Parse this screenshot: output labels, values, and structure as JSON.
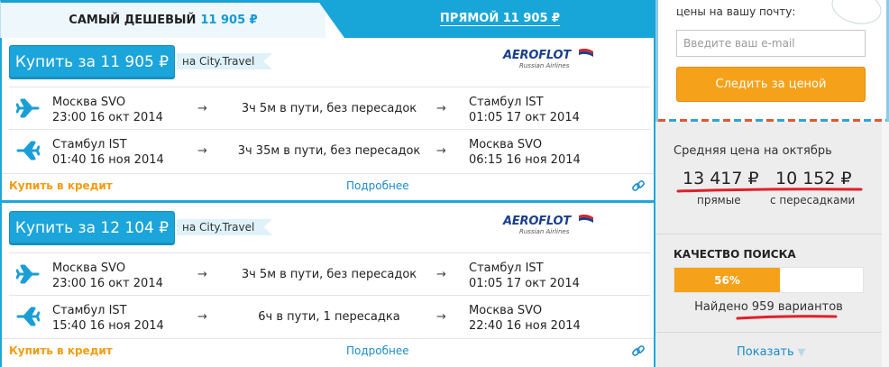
{
  "tabs": {
    "cheapest_label": "САМЫЙ ДЕШЕВЫЙ",
    "cheapest_price": "11 905 ₽",
    "direct_label": "ПРЯМОЙ 11 905 ₽"
  },
  "results": [
    {
      "buy_label": "Купить за 11 905 ₽",
      "agent": "на City.Travel",
      "airline": "AEROFLOT",
      "airline_sub": "Russian Airlines",
      "segments": [
        {
          "from_city": "Москва SVO",
          "from_time": "23:00 16 окт 2014",
          "duration": "3ч 5м в пути, без пересадок",
          "to_city": "Стамбул IST",
          "to_time": "01:05 17 окт 2014",
          "arrow": "→"
        },
        {
          "from_city": "Стамбул IST",
          "from_time": "01:40 16 ноя 2014",
          "duration": "3ч 35м в пути, без пересадок",
          "to_city": "Москва SVO",
          "to_time": "06:15 16 ноя 2014",
          "arrow": "→"
        }
      ],
      "credit": "Купить в кредит",
      "details": "Подробнее"
    },
    {
      "buy_label": "Купить за 12 104 ₽",
      "agent": "на City.Travel",
      "airline": "AEROFLOT",
      "airline_sub": "Russian Airlines",
      "segments": [
        {
          "from_city": "Москва SVO",
          "from_time": "23:00 16 окт 2014",
          "duration": "3ч 5м в пути, без пересадок",
          "to_city": "Стамбул IST",
          "to_time": "01:05 17 окт 2014",
          "arrow": "→"
        },
        {
          "from_city": "Стамбул IST",
          "from_time": "15:40 16 ноя 2014",
          "duration": "6ч в пути, 1 пересадка",
          "to_city": "Москва SVO",
          "to_time": "22:40 16 ноя 2014",
          "arrow": "→"
        }
      ],
      "credit": "Купить в кредит",
      "details": "Подробнее"
    }
  ],
  "subscribe": {
    "text": "цены на вашу почту:",
    "email_placeholder": "Введите ваш e-mail",
    "button": "Следить за ценой"
  },
  "average": {
    "title": "Средняя цена на октябрь",
    "direct_price": "13 417 ₽",
    "direct_label": "прямые",
    "transfer_price": "10 152 ₽",
    "transfer_label": "с пересадками"
  },
  "quality": {
    "title": "КАЧЕСТВО ПОИСКА",
    "percent": 56,
    "percent_label": "56%",
    "found": "Найдено 959 вариантов",
    "show": "Показать",
    "show_arrow": "▼"
  },
  "colors": {
    "accent_blue": "#1ba5da",
    "orange": "#f5a21a",
    "red_underline": "#e0202a"
  },
  "icons": {
    "segment": "airplane-icon",
    "footer": "link-icon"
  }
}
